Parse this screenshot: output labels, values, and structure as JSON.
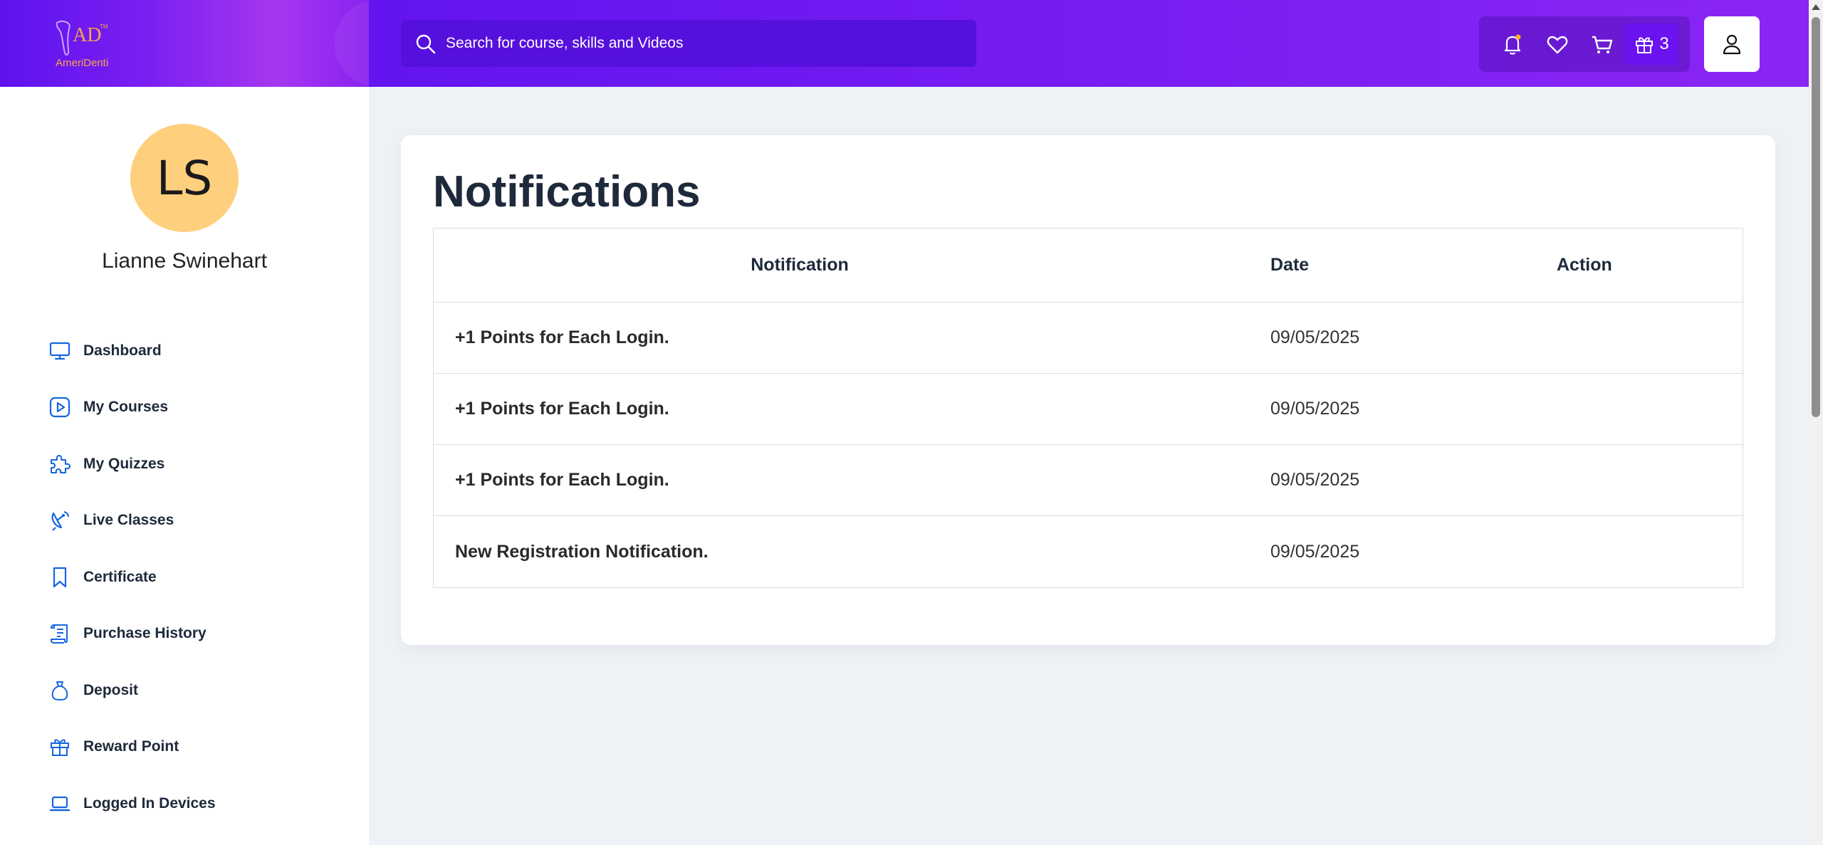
{
  "header": {
    "logo_text": "AmeriDenti",
    "logo_mark": "AD",
    "search_placeholder": "Search for course, skills and Videos",
    "icons": [
      "bell-icon",
      "heart-icon",
      "cart-icon",
      "gift-icon",
      "user-icon"
    ],
    "reward_count": "3",
    "colors": {
      "header_bg": "#6a17f0",
      "search_bg": "#5610dd",
      "badge_bg": "#6a12f0"
    }
  },
  "sidebar": {
    "avatar_initials": "LS",
    "avatar_color": "#fecf7d",
    "user_name": "Lianne Swinehart",
    "items": [
      {
        "label": "Dashboard",
        "icon": "monitor-icon"
      },
      {
        "label": "My Courses",
        "icon": "play-square-icon"
      },
      {
        "label": "My Quizzes",
        "icon": "puzzle-icon"
      },
      {
        "label": "Live Classes",
        "icon": "satellite-dish-icon"
      },
      {
        "label": "Certificate",
        "icon": "bookmark-icon"
      },
      {
        "label": "Purchase History",
        "icon": "receipt-icon"
      },
      {
        "label": "Deposit",
        "icon": "money-bag-icon"
      },
      {
        "label": "Reward Point",
        "icon": "gift-icon"
      },
      {
        "label": "Logged In Devices",
        "icon": "laptop-icon"
      }
    ]
  },
  "main": {
    "title": "Notifications",
    "table": {
      "headers": {
        "notification": "Notification",
        "date": "Date",
        "action": "Action"
      },
      "rows": [
        {
          "notification": "+1 Points for Each Login.",
          "date": "09/05/2025"
        },
        {
          "notification": "+1 Points for Each Login.",
          "date": "09/05/2025"
        },
        {
          "notification": "+1 Points for Each Login.",
          "date": "09/05/2025"
        },
        {
          "notification": "New Registration Notification.",
          "date": "09/05/2025"
        }
      ]
    }
  }
}
